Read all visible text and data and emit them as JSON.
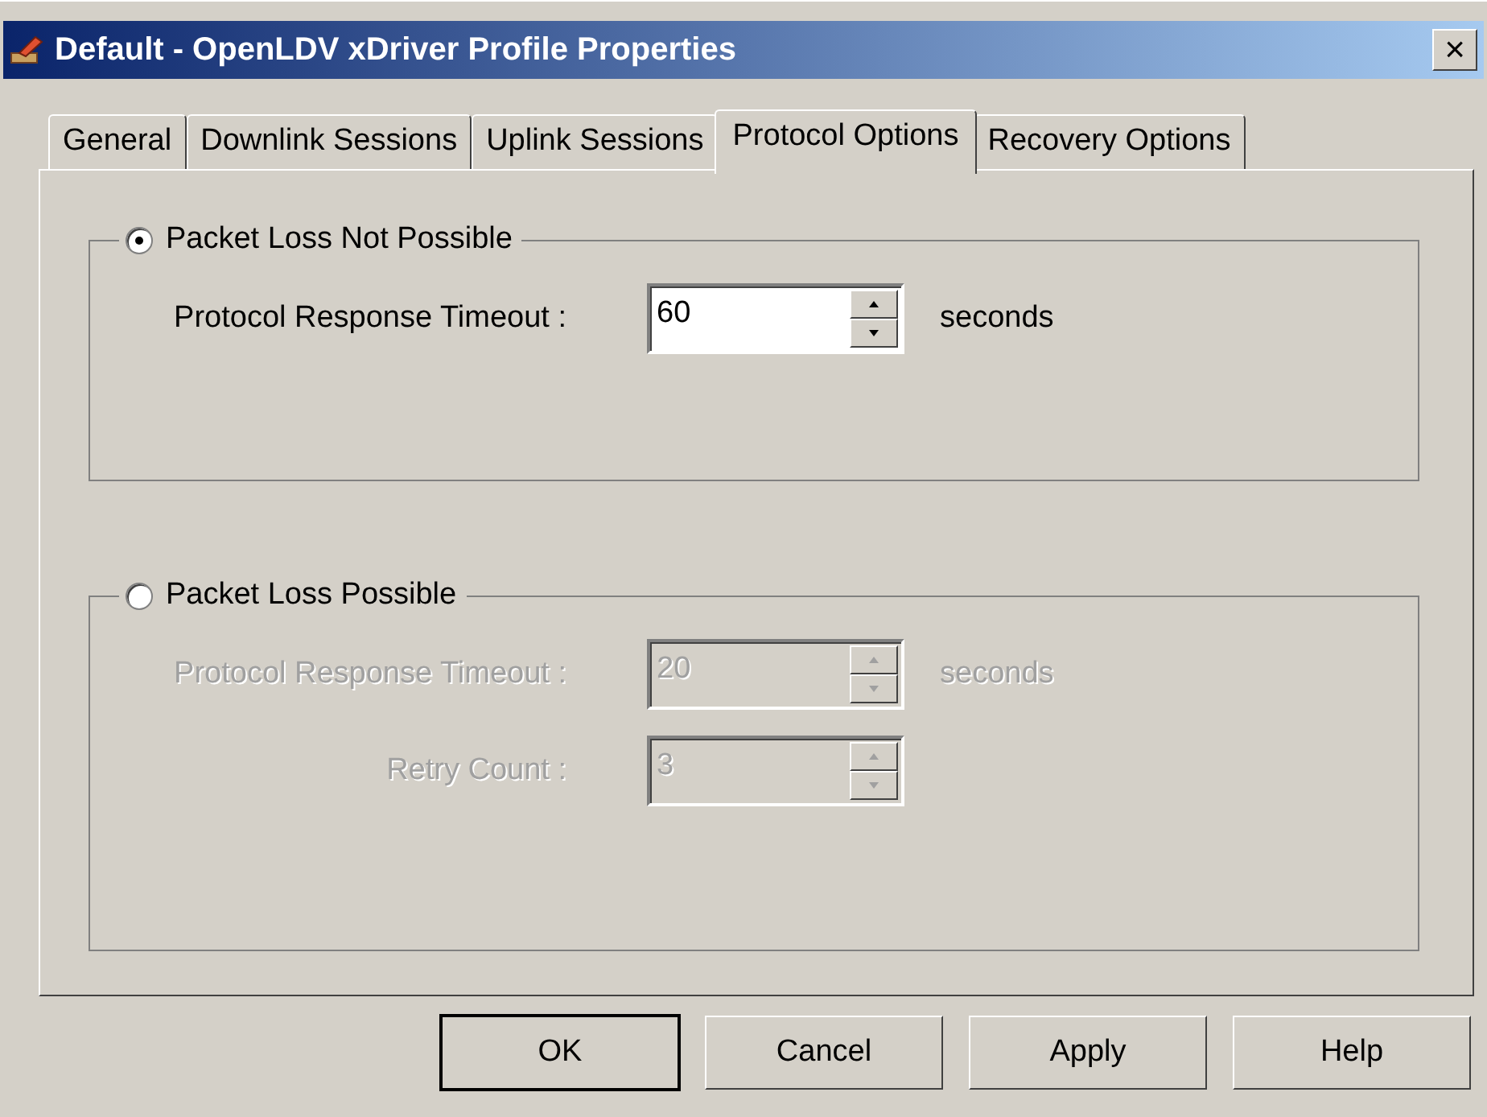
{
  "window": {
    "title": "Default - OpenLDV xDriver Profile Properties",
    "close": "×"
  },
  "tabs": [
    {
      "label": "General",
      "selected": false
    },
    {
      "label": "Downlink Sessions",
      "selected": false
    },
    {
      "label": "Uplink Sessions",
      "selected": false
    },
    {
      "label": "Protocol Options",
      "selected": true
    },
    {
      "label": "Recovery Options",
      "selected": false
    }
  ],
  "groups": [
    {
      "label": "Packet Loss Not Possible",
      "selected": true,
      "fields": [
        {
          "label": "Protocol Response Timeout :",
          "value": "60",
          "unit": "seconds",
          "disabled": false
        }
      ]
    },
    {
      "label": "Packet Loss Possible",
      "selected": false,
      "fields": [
        {
          "label": "Protocol Response Timeout :",
          "value": "20",
          "unit": "seconds",
          "disabled": true
        },
        {
          "label": "Retry Count :",
          "value": "3",
          "disabled": true
        }
      ]
    }
  ],
  "buttons": [
    {
      "label": "OK",
      "default": true
    },
    {
      "label": "Cancel",
      "default": false
    },
    {
      "label": "Apply",
      "default": false
    },
    {
      "label": "Help",
      "default": false
    }
  ]
}
